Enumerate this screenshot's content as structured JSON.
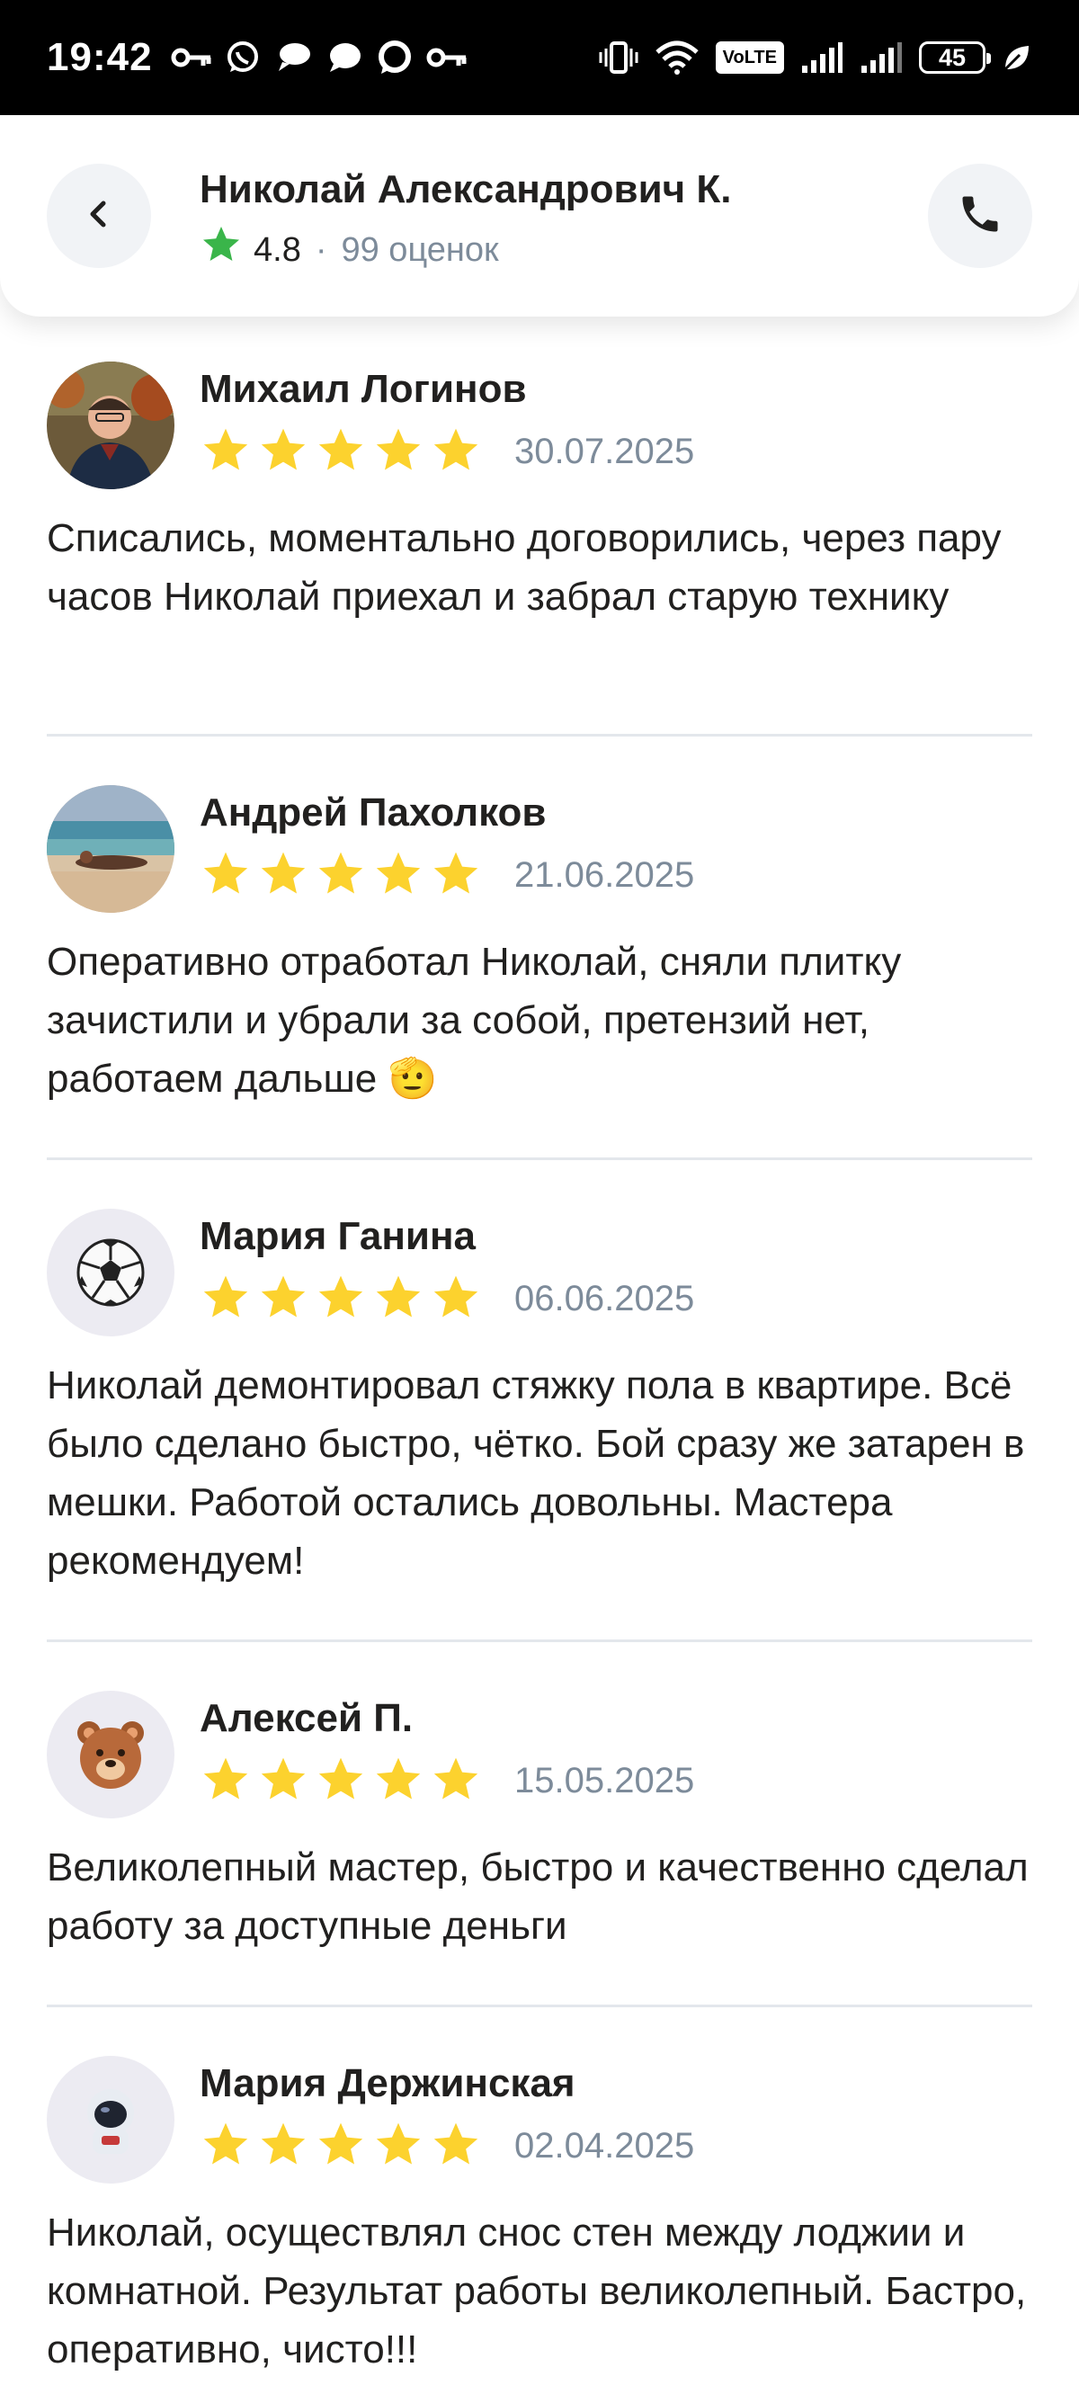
{
  "status_bar": {
    "time": "19:42",
    "volte": "VoLTE",
    "battery": "45"
  },
  "header": {
    "name": "Николай Александрович К.",
    "rating": "4.8",
    "separator": "·",
    "ratings_count": "99 оценок",
    "star_color": "#3ab54a"
  },
  "colors": {
    "review_star": "#fcd22e",
    "muted_text": "#7d8b9a",
    "separator": "#e3e7ec"
  },
  "reviews": [
    {
      "author": "Михаил Логинов",
      "avatar": "photo",
      "stars": 5,
      "date": "30.07.2025",
      "text": "Списались, моментально договорились, через пару часов Николай приехал и забрал старую технику"
    },
    {
      "author": "Андрей Пахолков",
      "avatar": "photo-beach",
      "stars": 5,
      "date": "21.06.2025",
      "text": "Оперативно отработал Николай, сняли плитку зачистили и убрали за собой, претензий нет, работаем дальше 🫡"
    },
    {
      "author": "Мария Ганина",
      "avatar": "⚽",
      "stars": 5,
      "date": "06.06.2025",
      "text": "Николай демонтировал стяжку пола в квартире. Всё было сделано быстро, чётко. Бой сразу же затарен в мешки. Работой остались довольны. Мастера рекомендуем!"
    },
    {
      "author": "Алексей П.",
      "avatar": "🐻",
      "stars": 5,
      "date": "15.05.2025",
      "text": "Великолепный мастер, быстро и качественно сделал работу за доступные деньги"
    },
    {
      "author": "Мария Держинская",
      "avatar": "👨‍🚀",
      "stars": 5,
      "date": "02.04.2025",
      "text": "Николай, осуществлял снос стен между лоджии и комнатной. Результат работы великолепный. Бастро, оперативно, чисто!!!"
    }
  ]
}
